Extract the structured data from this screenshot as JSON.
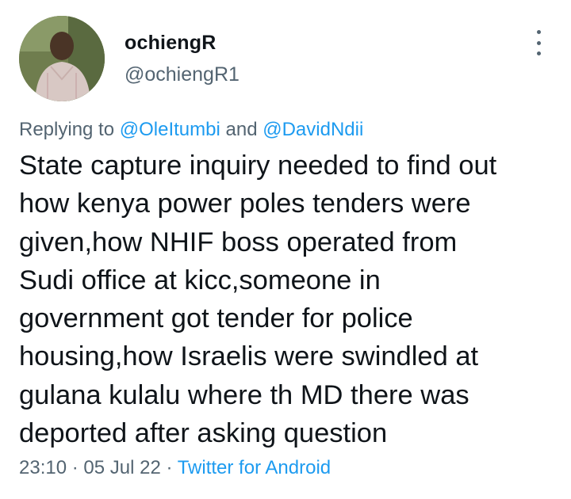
{
  "user": {
    "display_name": "ochiengR",
    "handle": "@ochiengR1",
    "avatar_icon": "profile-photo"
  },
  "reply": {
    "prefix": "Replying to ",
    "mention_1": "@OleItumbi",
    "conjunction": " and ",
    "mention_2": "@DavidNdii"
  },
  "tweet": {
    "text": "State capture inquiry needed to find out\nhow kenya power poles tenders were\ngiven,how NHIF boss operated from\nSudi office at kicc,someone in\ngovernment got tender for police\nhousing,how Israelis were swindled at\ngulana kulalu where th MD there was\ndeported after asking question"
  },
  "meta": {
    "time": "23:10",
    "separator_1": " · ",
    "date": "05 Jul 22",
    "separator_2": " · ",
    "source": "Twitter for Android"
  },
  "colors": {
    "text_primary": "#0f1419",
    "text_secondary": "#536471",
    "link": "#1d9bf0"
  },
  "icons": {
    "more_menu": "more-vertical-icon"
  }
}
